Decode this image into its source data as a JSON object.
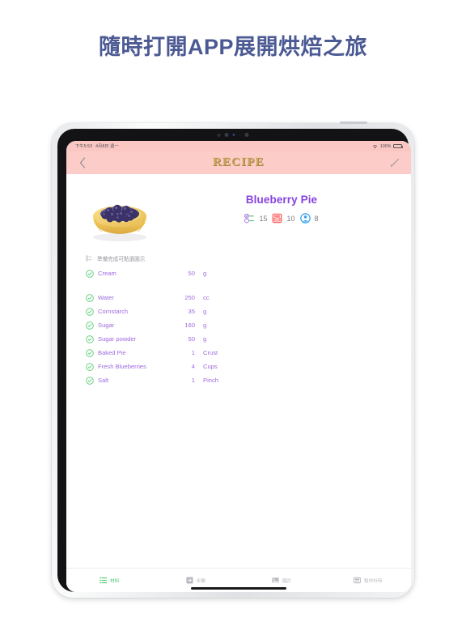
{
  "headline": "隨時打開APP展開烘焙之旅",
  "device": {
    "status_bar": {
      "time": "下午5:53",
      "date": "4月8日 週一",
      "wifi_icon": "wifi-icon",
      "battery_percent": "100%",
      "battery_icon": "battery-full-icon"
    },
    "nav_bar": {
      "back_icon": "chevron-left-icon",
      "app_title": "RECIPE",
      "edit_icon": "pencil-icon"
    }
  },
  "recipe": {
    "image_alt": "blueberry-pie-photo",
    "title": "Blueberry Pie",
    "meta": [
      {
        "icon": "prep-list-icon",
        "value": "15",
        "color": "#a06be0"
      },
      {
        "icon": "oven-icon",
        "value": "10",
        "color": "#fa5252"
      },
      {
        "icon": "servings-person-icon",
        "value": "8",
        "color": "#2e9ff0"
      }
    ],
    "prep_note": "準備完成可點選圖示",
    "prep_note_icon": "list-icon",
    "ingredients": [
      {
        "checked": true,
        "name": "Cream",
        "amount": "50",
        "unit": "g",
        "gap_after": true
      },
      {
        "checked": true,
        "name": "Water",
        "amount": "250",
        "unit": "cc",
        "gap_after": false
      },
      {
        "checked": true,
        "name": "Cornstarch",
        "amount": "35",
        "unit": "g",
        "gap_after": false
      },
      {
        "checked": true,
        "name": "Sugar",
        "amount": "160",
        "unit": "g",
        "gap_after": false
      },
      {
        "checked": true,
        "name": "Sugar powder",
        "amount": "50",
        "unit": "g",
        "gap_after": false
      },
      {
        "checked": true,
        "name": "Baked Pie",
        "amount": "1",
        "unit": "Crust",
        "gap_after": false
      },
      {
        "checked": true,
        "name": "Fresh Blueberries",
        "amount": "4",
        "unit": "Cups",
        "gap_after": false
      },
      {
        "checked": true,
        "name": "Salt",
        "amount": "1",
        "unit": "Pinch",
        "gap_after": false
      }
    ]
  },
  "tabs": [
    {
      "label": "材料",
      "icon": "list-icon",
      "active": true
    },
    {
      "label": "步驟",
      "icon": "steps-arrow-icon",
      "active": false
    },
    {
      "label": "圖片",
      "icon": "photo-icon",
      "active": false
    },
    {
      "label": "製作計時",
      "icon": "timer-icon",
      "active": false
    }
  ],
  "colors": {
    "headline": "#4c5a94",
    "nav_bar": "#fcccc8",
    "status_bar": "#fbc7c3",
    "logo_gold": "#c8a25c",
    "title_purple": "#8743df",
    "ingredient_purple": "#a06be0",
    "check_green": "#4fcc6a",
    "oven_red": "#fa5252",
    "person_blue": "#2e9ff0"
  }
}
